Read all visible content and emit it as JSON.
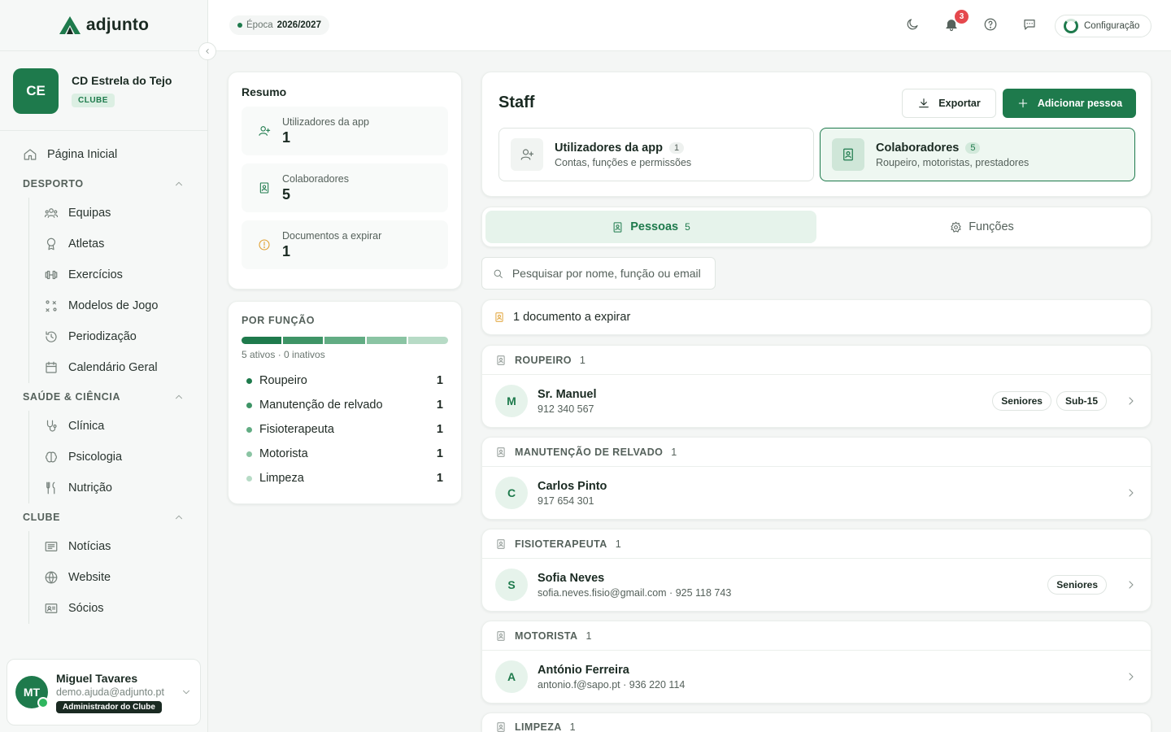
{
  "brand": {
    "name": "adjunto"
  },
  "club": {
    "initials": "CE",
    "name": "CD Estrela do Tejo",
    "tag": "CLUBE"
  },
  "nav": {
    "home": "Página Inicial",
    "sections": [
      {
        "title": "DESPORTO",
        "items": [
          "Equipas",
          "Atletas",
          "Exercícios",
          "Modelos de Jogo",
          "Periodização",
          "Calendário Geral"
        ]
      },
      {
        "title": "SAÚDE & CIÊNCIA",
        "items": [
          "Clínica",
          "Psicologia",
          "Nutrição"
        ]
      },
      {
        "title": "CLUBE",
        "items": [
          "Notícias",
          "Website",
          "Sócios"
        ]
      }
    ]
  },
  "user": {
    "initials": "MT",
    "name": "Miguel Tavares",
    "email": "demo.ajuda@adjunto.pt",
    "role": "Administrador do Clube"
  },
  "topbar": {
    "season_label": "Época",
    "season_value": "2026/2027",
    "notifications": "3",
    "config_label": "Configuração"
  },
  "summary": {
    "title": "Resumo",
    "items": [
      {
        "label": "Utilizadores da app",
        "value": "1",
        "icon": "user-add-icon"
      },
      {
        "label": "Colaboradores",
        "value": "5",
        "icon": "badge-icon"
      },
      {
        "label": "Documentos a expirar",
        "value": "1",
        "icon": "warning-icon"
      }
    ]
  },
  "by_role": {
    "title": "POR FUNÇÃO",
    "note": "5 ativos · 0 inativos",
    "roles": [
      {
        "name": "Roupeiro",
        "count": "1",
        "color": "#1e7a4c"
      },
      {
        "name": "Manutenção de relvado",
        "count": "1",
        "color": "#3e9466"
      },
      {
        "name": "Fisioterapeuta",
        "count": "1",
        "color": "#62ac83"
      },
      {
        "name": "Motorista",
        "count": "1",
        "color": "#8ac4a3"
      },
      {
        "name": "Limpeza",
        "count": "1",
        "color": "#b7dbc6"
      }
    ]
  },
  "staff": {
    "title": "Staff",
    "export_label": "Exportar",
    "add_label": "Adicionar pessoa",
    "segments": [
      {
        "title": "Utilizadores da app",
        "count": "1",
        "subtitle": "Contas, funções e permissões"
      },
      {
        "title": "Colaboradores",
        "count": "5",
        "subtitle": "Roupeiro, motoristas, prestadores"
      }
    ]
  },
  "tabs": [
    {
      "label": "Pessoas",
      "count": "5"
    },
    {
      "label": "Funções",
      "count": ""
    }
  ],
  "search": {
    "placeholder": "Pesquisar por nome, função ou email"
  },
  "alert": {
    "text": "1 documento a expirar"
  },
  "groups": [
    {
      "title": "ROUPEIRO",
      "count": "1",
      "person": {
        "initial": "M",
        "name": "Sr. Manuel",
        "contact": "912 340 567",
        "tags": [
          "Seniores",
          "Sub-15"
        ]
      }
    },
    {
      "title": "MANUTENÇÃO DE RELVADO",
      "count": "1",
      "person": {
        "initial": "C",
        "name": "Carlos Pinto",
        "contact": "917 654 301",
        "tags": []
      }
    },
    {
      "title": "FISIOTERAPEUTA",
      "count": "1",
      "person": {
        "initial": "S",
        "name": "Sofia Neves",
        "contact": "sofia.neves.fisio@gmail.com · 925 118 743",
        "tags": [
          "Seniores"
        ]
      }
    },
    {
      "title": "MOTORISTA",
      "count": "1",
      "person": {
        "initial": "A",
        "name": "António Ferreira",
        "contact": "antonio.f@sapo.pt · 936 220 114",
        "tags": []
      }
    },
    {
      "title": "LIMPEZA",
      "count": "1"
    }
  ],
  "colors": {
    "accent": "#1e7a4c",
    "accent_soft": "#e6f3eb",
    "alert": "#e0a030",
    "badge": "#e5484d"
  }
}
